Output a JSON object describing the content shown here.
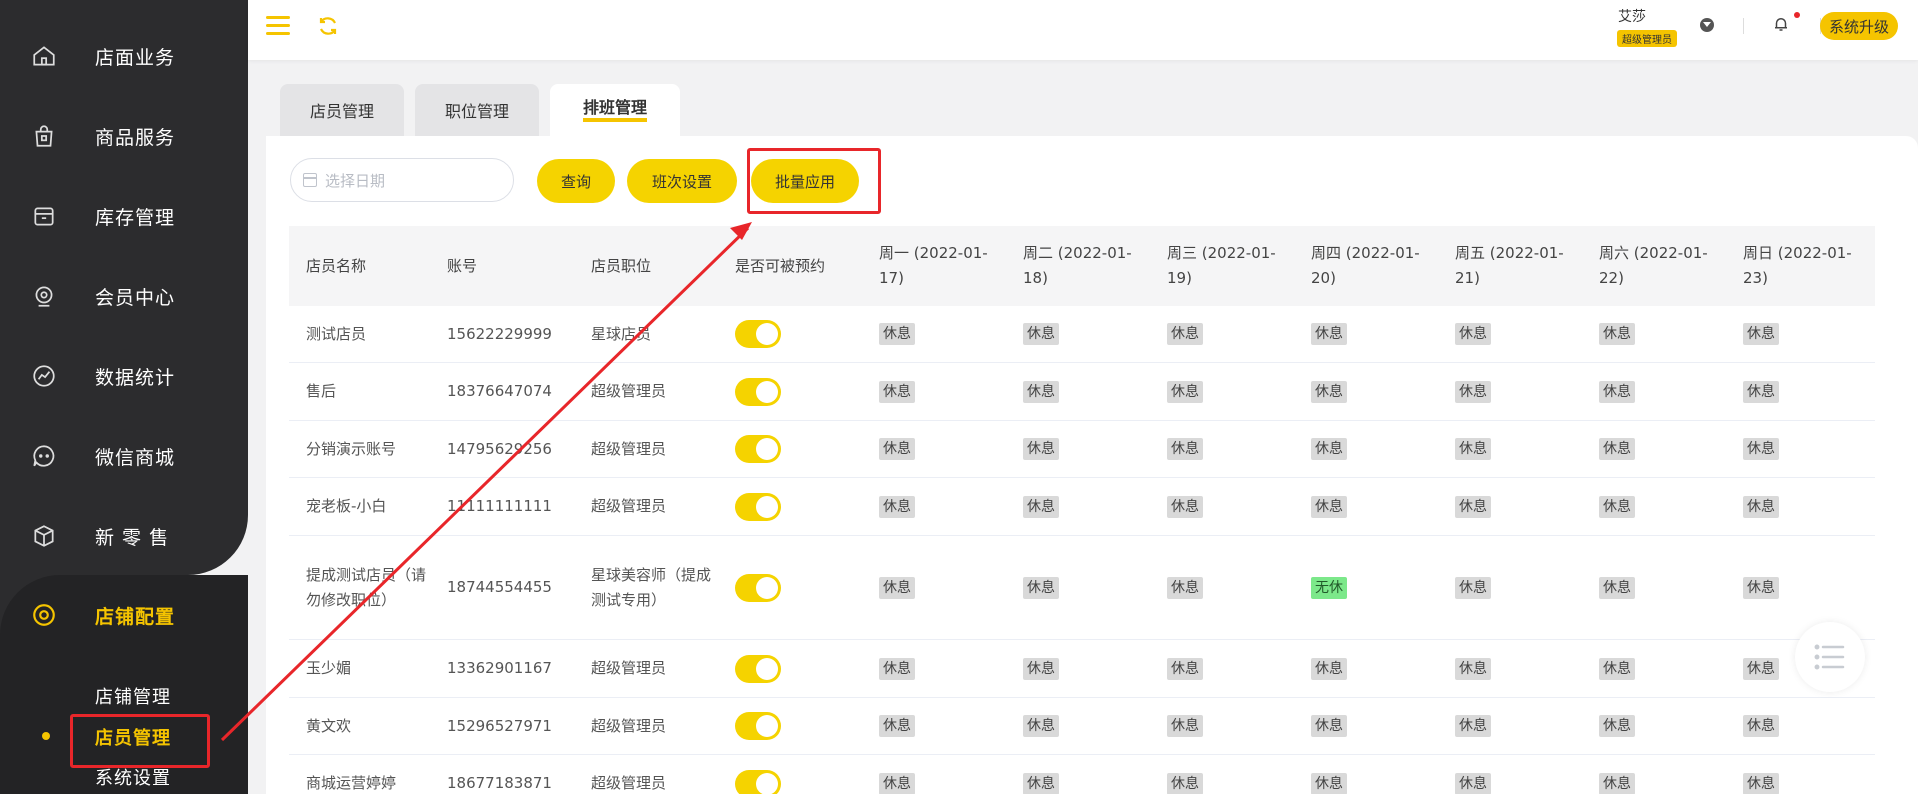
{
  "sidebar": {
    "nav": [
      {
        "label": "店面业务",
        "icon": "home-icon"
      },
      {
        "label": "商品服务",
        "icon": "bag-icon"
      },
      {
        "label": "库存管理",
        "icon": "box-icon"
      },
      {
        "label": "会员中心",
        "icon": "member-icon"
      },
      {
        "label": "数据统计",
        "icon": "chart-icon"
      },
      {
        "label": "微信商城",
        "icon": "chat-icon"
      },
      {
        "label": "新 零 售",
        "icon": "package-icon"
      },
      {
        "label": "店铺配置",
        "icon": "settings-icon"
      }
    ],
    "sub": [
      {
        "label": "店铺管理"
      },
      {
        "label": "店员管理"
      },
      {
        "label": "系统设置"
      }
    ]
  },
  "header": {
    "user_name": "艾莎",
    "user_role": "超级管理员",
    "upgrade_label": "系统升级"
  },
  "tabs": [
    {
      "label": "店员管理"
    },
    {
      "label": "职位管理"
    },
    {
      "label": "排班管理"
    }
  ],
  "toolbar": {
    "date_placeholder": "选择日期",
    "query_label": "查询",
    "shift_label": "班次设置",
    "batch_label": "批量应用"
  },
  "table": {
    "headers": [
      "店员名称",
      "账号",
      "店员职位",
      "是否可被预约",
      "周一 (2022-01-17)",
      "周二 (2022-01-18)",
      "周三 (2022-01-19)",
      "周四 (2022-01-20)",
      "周五 (2022-01-21)",
      "周六 (2022-01-22)",
      "周日 (2022-01-23)"
    ],
    "rows": [
      {
        "name": "测试店员",
        "account": "15622229999",
        "position": "星球店员",
        "days": [
          "休息",
          "休息",
          "休息",
          "休息",
          "休息",
          "休息",
          "休息"
        ]
      },
      {
        "name": "售后",
        "account": "18376647074",
        "position": "超级管理员",
        "days": [
          "休息",
          "休息",
          "休息",
          "休息",
          "休息",
          "休息",
          "休息"
        ]
      },
      {
        "name": "分销演示账号",
        "account": "14795629256",
        "position": "超级管理员",
        "days": [
          "休息",
          "休息",
          "休息",
          "休息",
          "休息",
          "休息",
          "休息"
        ]
      },
      {
        "name": "宠老板-小白",
        "account": "11111111111",
        "position": "超级管理员",
        "days": [
          "休息",
          "休息",
          "休息",
          "休息",
          "休息",
          "休息",
          "休息"
        ]
      },
      {
        "name": "提成测试店员（请勿修改职位）",
        "account": "18744554455",
        "position": "星球美容师（提成测试专用）",
        "days": [
          "休息",
          "休息",
          "休息",
          "无休",
          "休息",
          "休息",
          "休息"
        ]
      },
      {
        "name": "玉少媚",
        "account": "13362901167",
        "position": "超级管理员",
        "days": [
          "休息",
          "休息",
          "休息",
          "休息",
          "休息",
          "休息",
          "休息"
        ]
      },
      {
        "name": "黄文欢",
        "account": "15296527971",
        "position": "超级管理员",
        "days": [
          "休息",
          "休息",
          "休息",
          "休息",
          "休息",
          "休息",
          "休息"
        ]
      },
      {
        "name": "商城运营婷婷",
        "account": "18677183871",
        "position": "超级管理员",
        "days": [
          "休息",
          "休息",
          "休息",
          "休息",
          "休息",
          "休息",
          "休息"
        ]
      }
    ]
  },
  "colors": {
    "accent": "#f5d300",
    "sidebar_bg": "#2c2c2e",
    "highlight": "#e8262a"
  }
}
